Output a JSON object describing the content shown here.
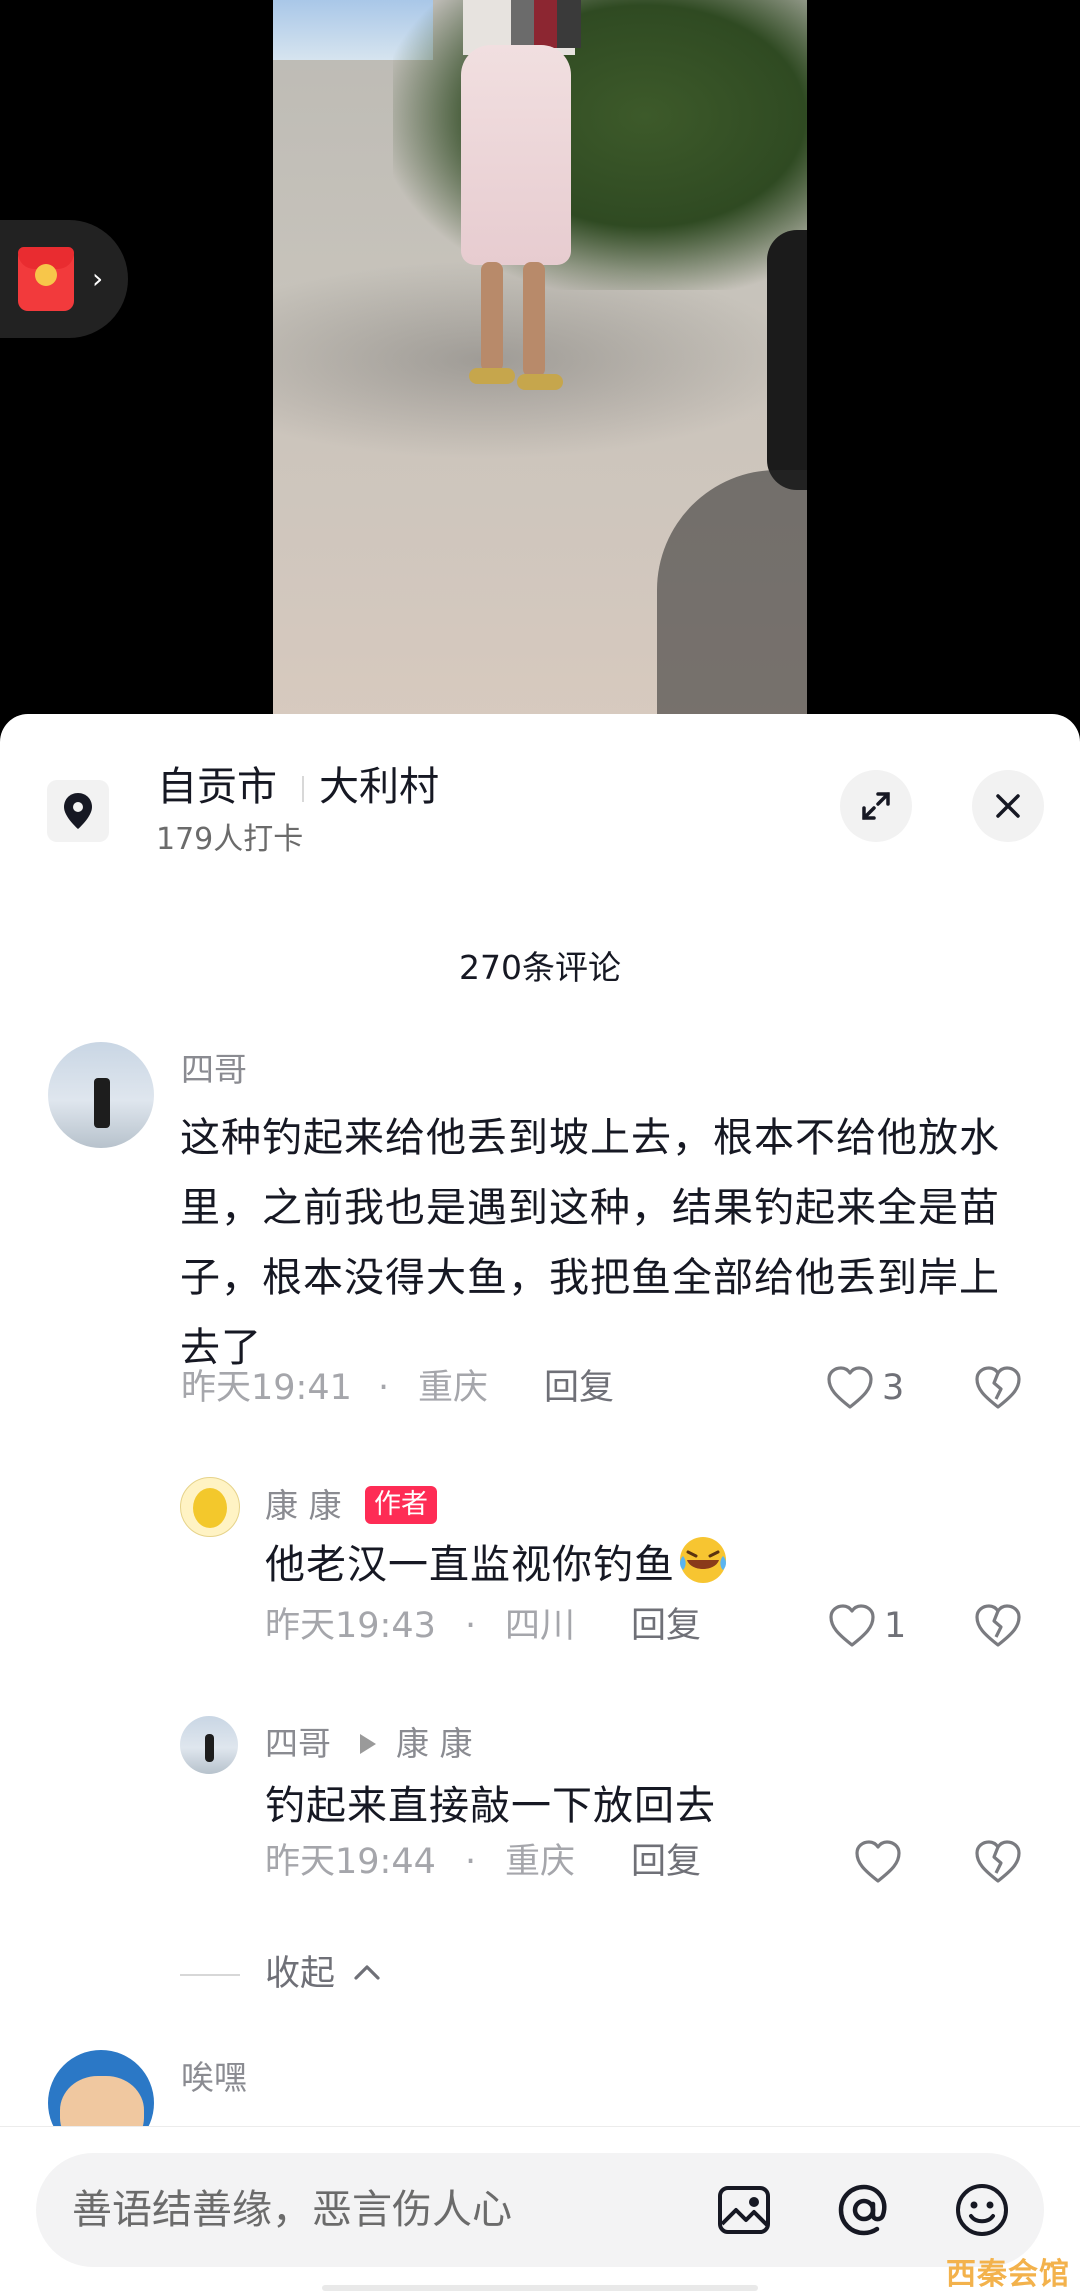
{
  "location": {
    "city": "自贡市",
    "village": "大利村",
    "checkin": "179人打卡"
  },
  "comments_header": {
    "count_label": "270条评论"
  },
  "comments": [
    {
      "user": "四哥",
      "text": "这种钓起来给他丢到坡上去，根本不给他放水里，之前我也是遇到这种，结果钓起来全是苗子，根本没得大鱼，我把鱼全部给他丢到岸上去了",
      "time": "昨天19:41",
      "region": "重庆",
      "reply_label": "回复",
      "likes": "3",
      "replies": [
        {
          "user": "康 康",
          "badge": "作者",
          "text": "他老汉一直监视你钓鱼",
          "time": "昨天19:43",
          "region": "四川",
          "reply_label": "回复",
          "likes": "1"
        },
        {
          "user": "四哥",
          "reply_to": "康 康",
          "text": "钓起来直接敲一下放回去",
          "time": "昨天19:44",
          "region": "重庆",
          "reply_label": "回复",
          "likes": ""
        }
      ],
      "collapse_label": "收起"
    },
    {
      "user": "唉嘿"
    }
  ],
  "input": {
    "placeholder": "善语结善缘，恶言伤人心"
  },
  "watermark": "西秦会馆",
  "icons": [
    "location-pin-icon",
    "expand-icon",
    "close-icon",
    "heart-icon",
    "broken-heart-icon",
    "chevron-up-icon",
    "image-icon",
    "at-icon",
    "emoji-icon",
    "red-packet-icon"
  ],
  "colors": {
    "author_badge": "#fe2c55",
    "text_primary": "#161823",
    "text_secondary": "#a5a6ab"
  }
}
